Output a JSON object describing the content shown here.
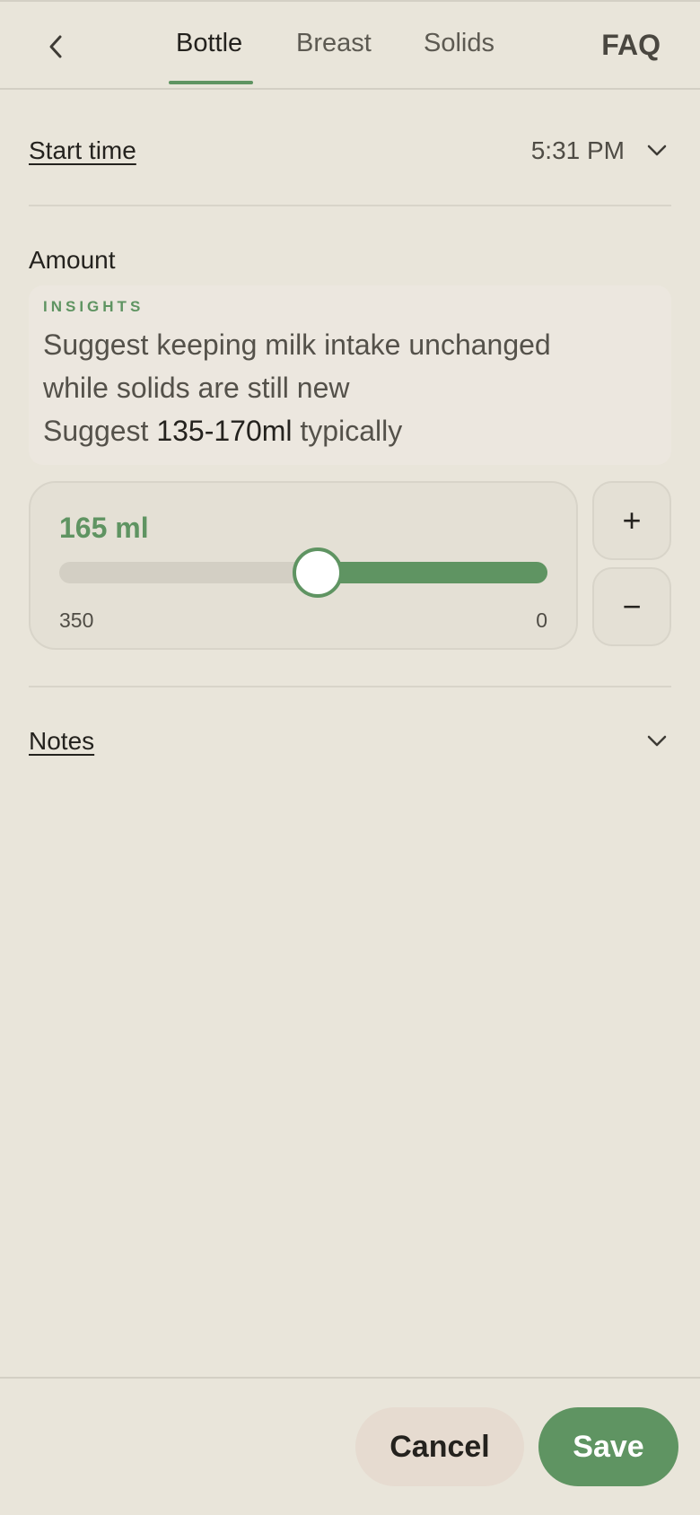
{
  "header": {
    "tabs": [
      {
        "label": "Bottle",
        "active": true
      },
      {
        "label": "Breast",
        "active": false
      },
      {
        "label": "Solids",
        "active": false
      }
    ],
    "faq_label": "FAQ"
  },
  "start_time": {
    "label": "Start time",
    "value": "5:31 PM"
  },
  "amount": {
    "label": "Amount",
    "insights": {
      "title": "INSIGHTS",
      "line1": "Suggest keeping milk intake unchanged",
      "line2": "while solids are still new",
      "line3_prefix": "Suggest ",
      "line3_highlight": "135-170ml",
      "line3_suffix": " typically"
    },
    "slider": {
      "value_label": "165 ml",
      "value": 165,
      "min_label": "350",
      "max_label": "0",
      "left_end_value": 350,
      "right_end_value": 0
    },
    "plus_label": "+",
    "minus_label": "−"
  },
  "notes": {
    "label": "Notes"
  },
  "footer": {
    "cancel_label": "Cancel",
    "save_label": "Save"
  },
  "colors": {
    "background": "#e9e5da",
    "accent": "#5f9462",
    "cancel_bg": "#e6dbd0"
  }
}
